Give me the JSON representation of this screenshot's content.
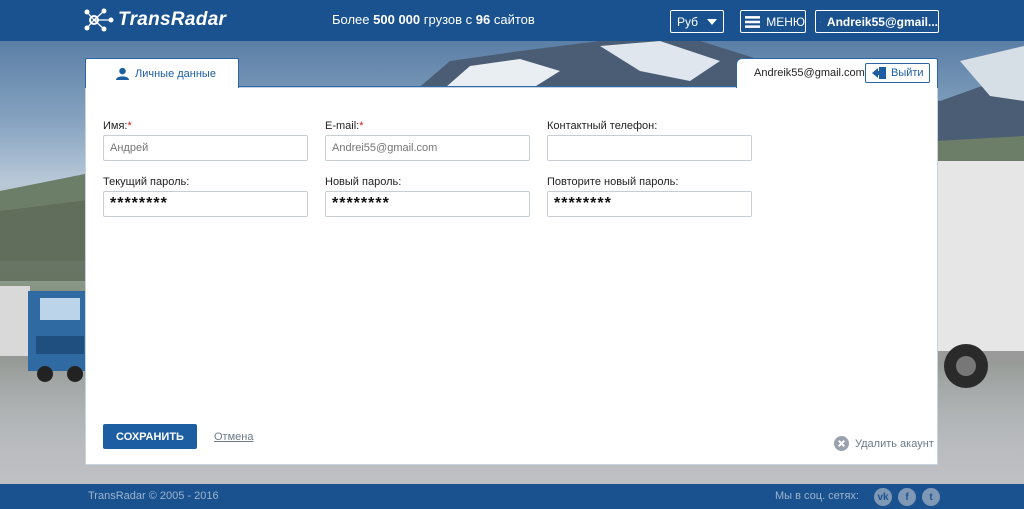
{
  "header": {
    "logo_text": "TransRadar",
    "tagline_prefix": "Более ",
    "tagline_count1": "500 000",
    "tagline_middle": " грузов с ",
    "tagline_count2": "96",
    "tagline_suffix": " сайтов",
    "currency": "Руб",
    "menu_label": "МЕНЮ",
    "user_label": "Andreik55@gmail..."
  },
  "tabs": {
    "personal_label": "Личные данные",
    "account_email": "Andreik55@gmail.com",
    "logout_label": "Выйти"
  },
  "form": {
    "name_label": "Имя:",
    "name_placeholder": "Андрей",
    "email_label": "E-mail:",
    "email_placeholder": "Andrei55@gmail.com",
    "phone_label": "Контактный телефон:",
    "phone_value": "",
    "current_pw_label": "Текущий пароль:",
    "current_pw_value": "********",
    "new_pw_label": "Новый пароль:",
    "new_pw_value": "********",
    "repeat_pw_label": "Повторите новый пароль:",
    "repeat_pw_value": "********",
    "required_mark": "*"
  },
  "actions": {
    "save_label": "СОХРАНИТЬ",
    "cancel_label": "Отмена",
    "delete_label": "Удалить акаунт"
  },
  "footer": {
    "copyright": "TransRadar © 2005 - 2016",
    "social_label": "Мы в соц. сетях:",
    "social_icons": [
      "vk-icon",
      "facebook-icon",
      "twitter-icon"
    ]
  },
  "colors": {
    "brand_blue": "#1a5290",
    "link_blue": "#1d5ea3",
    "required_red": "#d21b1b"
  }
}
